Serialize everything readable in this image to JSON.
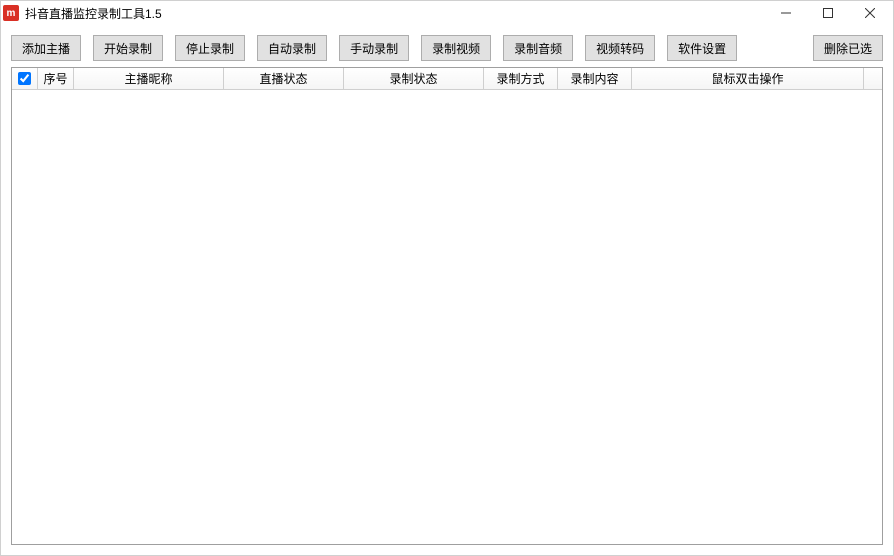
{
  "window": {
    "title": "抖音直播监控录制工具1.5"
  },
  "toolbar": {
    "add": "添加主播",
    "start": "开始录制",
    "stop": "停止录制",
    "auto": "自动录制",
    "manual": "手动录制",
    "recvideo": "录制视频",
    "recaudio": "录制音频",
    "transcode": "视频转码",
    "settings": "软件设置",
    "delsel": "删除已选"
  },
  "columns": {
    "idx": "序号",
    "nick": "主播昵称",
    "live": "直播状态",
    "rec": "录制状态",
    "mode": "录制方式",
    "content": "录制内容",
    "action": "鼠标双击操作"
  }
}
